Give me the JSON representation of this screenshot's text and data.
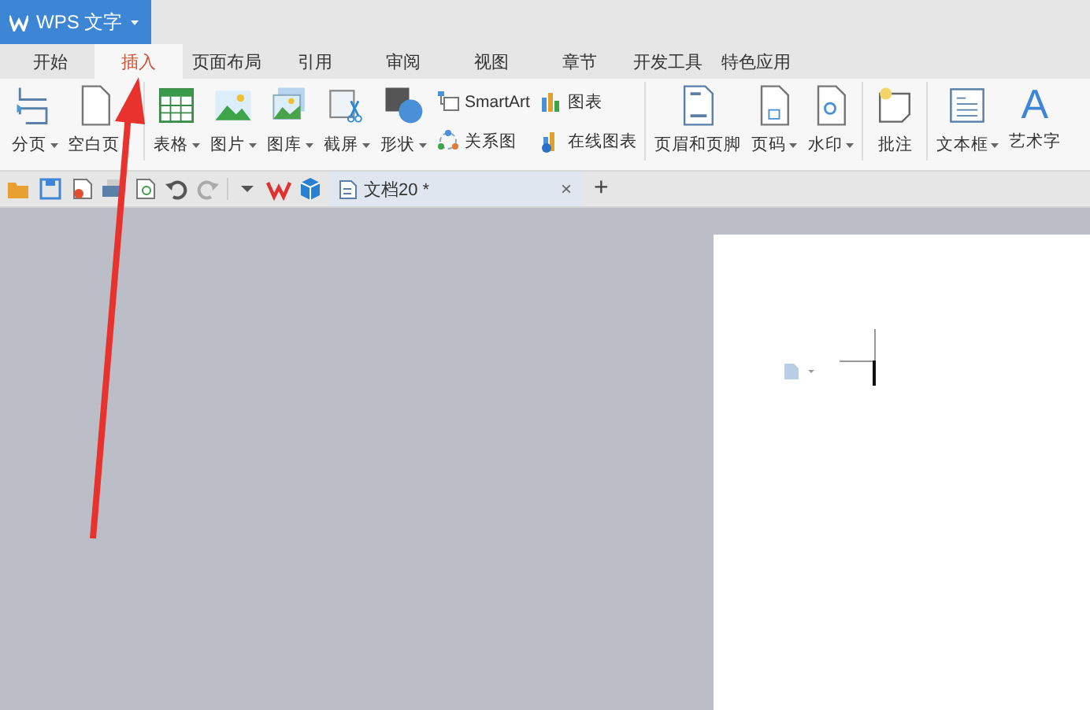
{
  "title_bar": {
    "app_button": "WPS 文字",
    "has_menu": true
  },
  "tabs": [
    {
      "label": "开始",
      "selected": false
    },
    {
      "label": "插入",
      "selected": true
    },
    {
      "label": "页面布局",
      "selected": false
    },
    {
      "label": "引用",
      "selected": false
    },
    {
      "label": "审阅",
      "selected": false
    },
    {
      "label": "视图",
      "selected": false
    },
    {
      "label": "章节",
      "selected": false
    },
    {
      "label": "开发工具",
      "selected": false
    },
    {
      "label": "特色应用",
      "selected": false
    }
  ],
  "ribbon": {
    "groups": [
      {
        "items": [
          {
            "kind": "large",
            "label": "分页",
            "has_menu": true
          },
          {
            "kind": "large",
            "label": "空白页",
            "has_menu": false
          }
        ]
      },
      {
        "items": [
          {
            "kind": "large",
            "label": "表格",
            "has_menu": true
          },
          {
            "kind": "large",
            "label": "图片",
            "has_menu": true
          },
          {
            "kind": "large",
            "label": "图库",
            "has_menu": true
          },
          {
            "kind": "large",
            "label": "截屏",
            "has_menu": true
          },
          {
            "kind": "large",
            "label": "形状",
            "has_menu": true
          },
          {
            "kind": "column",
            "items": [
              {
                "label": "SmartArt"
              },
              {
                "label": "关系图"
              }
            ]
          },
          {
            "kind": "column",
            "items": [
              {
                "label": "图表"
              },
              {
                "label": "在线图表"
              }
            ]
          }
        ]
      },
      {
        "items": [
          {
            "kind": "large",
            "label": "页眉和页脚",
            "has_menu": false
          },
          {
            "kind": "large",
            "label": "页码",
            "has_menu": true
          },
          {
            "kind": "large",
            "label": "水印",
            "has_menu": true
          }
        ]
      },
      {
        "items": [
          {
            "kind": "large",
            "label": "批注",
            "has_menu": false
          }
        ]
      },
      {
        "items": [
          {
            "kind": "large",
            "label": "文本框",
            "has_menu": true
          },
          {
            "kind": "large",
            "label": "艺术字",
            "has_menu": false,
            "glyph": "A"
          }
        ]
      }
    ]
  },
  "document_tabs": [
    {
      "title": "文档20 *",
      "close": "×"
    }
  ],
  "new_tab": "+"
}
